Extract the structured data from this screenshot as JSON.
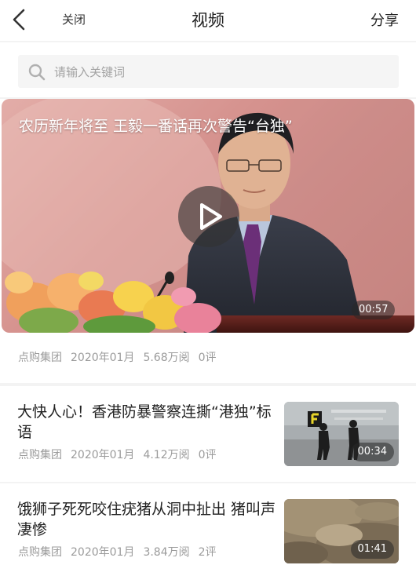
{
  "header": {
    "close_label": "关闭",
    "title": "视频",
    "share_label": "分享"
  },
  "search": {
    "placeholder": "请输入关键词"
  },
  "featured": {
    "title": "农历新年将至 王毅一番话再次警告“台独”",
    "duration": "00:57",
    "meta": {
      "source": "点购集团",
      "date": "2020年01月",
      "views": "5.68万阅",
      "comments": "0评"
    }
  },
  "videos": [
    {
      "title": "大快人心！香港防暴警察连撕“港独”标语",
      "duration": "00:34",
      "meta": {
        "source": "点购集团",
        "date": "2020年01月",
        "views": "4.12万阅",
        "comments": "0评"
      }
    },
    {
      "title": "饿狮子死死咬住疣猪从洞中扯出 猪叫声凄惨",
      "duration": "01:41",
      "meta": {
        "source": "点购集团",
        "date": "2020年01月",
        "views": "3.84万阅",
        "comments": "2评"
      }
    }
  ],
  "icons": {
    "back": "chevron-left-icon",
    "search": "search-icon",
    "play": "play-icon"
  }
}
